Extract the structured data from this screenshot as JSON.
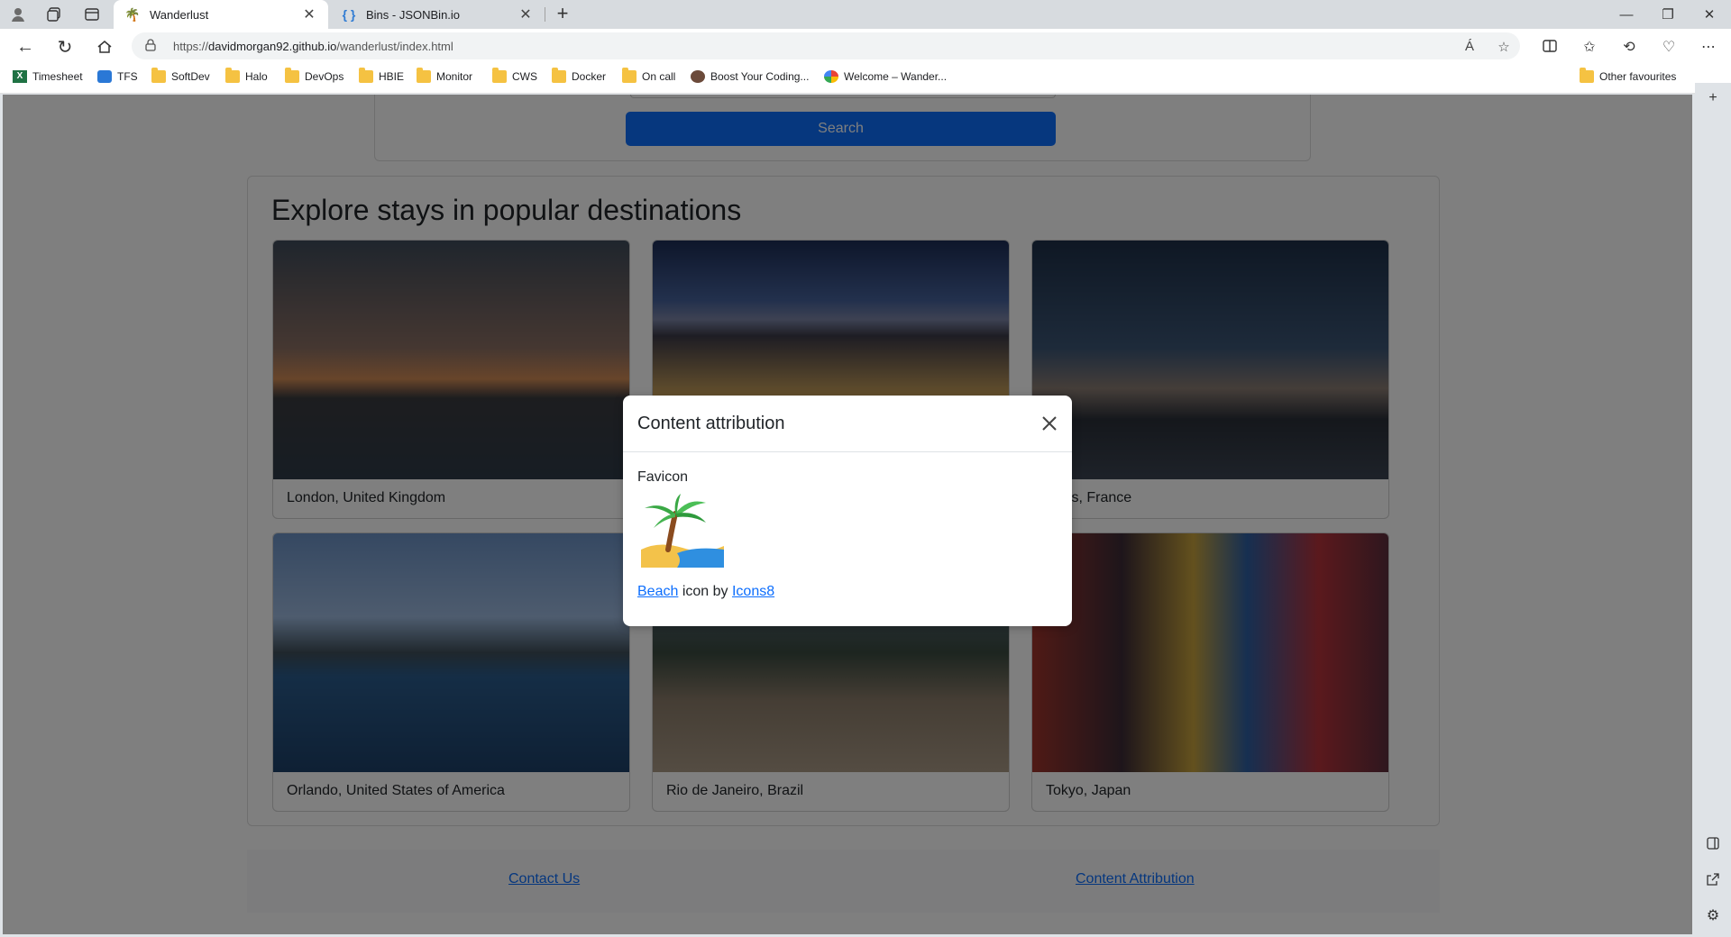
{
  "browser": {
    "tabs": [
      {
        "title": "Wanderlust",
        "active": true
      },
      {
        "title": "Bins - JSONBin.io",
        "active": false
      }
    ],
    "url_prefix": "https://",
    "url_host": "davidmorgan92.github.io",
    "url_path": "/wanderlust/index.html",
    "read_aloud_label": "Á",
    "bookmarks": [
      {
        "label": "Timesheet",
        "icon": "excel-icon"
      },
      {
        "label": "TFS",
        "icon": "tfs-icon"
      },
      {
        "label": "SoftDev",
        "icon": "folder-icon"
      },
      {
        "label": "Halo",
        "icon": "folder-icon"
      },
      {
        "label": "DevOps",
        "icon": "folder-icon"
      },
      {
        "label": "HBIE",
        "icon": "folder-icon"
      },
      {
        "label": "Monitor",
        "icon": "folder-icon"
      },
      {
        "label": "CWS",
        "icon": "folder-icon"
      },
      {
        "label": "Docker",
        "icon": "folder-icon"
      },
      {
        "label": "On call",
        "icon": "folder-icon"
      },
      {
        "label": "Boost Your Coding...",
        "icon": "avatar-icon"
      },
      {
        "label": "Welcome – Wander...",
        "icon": "google-cloud-icon"
      }
    ],
    "other_favourites": "Other favourites"
  },
  "page": {
    "search_button": "Search",
    "dest_title": "Explore stays in popular destinations",
    "cities": [
      {
        "name": "London, United Kingdom"
      },
      {
        "name": ""
      },
      {
        "name": "Paris, France"
      },
      {
        "name": "Orlando, United States of America"
      },
      {
        "name": "Rio de Janeiro, Brazil"
      },
      {
        "name": "Tokyo, Japan"
      }
    ],
    "footer": {
      "contact": "Contact Us",
      "attribution": "Content Attribution"
    }
  },
  "modal": {
    "title": "Content attribution",
    "section": "Favicon",
    "link1": "Beach",
    "middle": " icon by ",
    "link2": "Icons8"
  },
  "colors": {
    "primary": "#0d6efd",
    "overlay": "rgba(0,0,0,0.5)"
  }
}
